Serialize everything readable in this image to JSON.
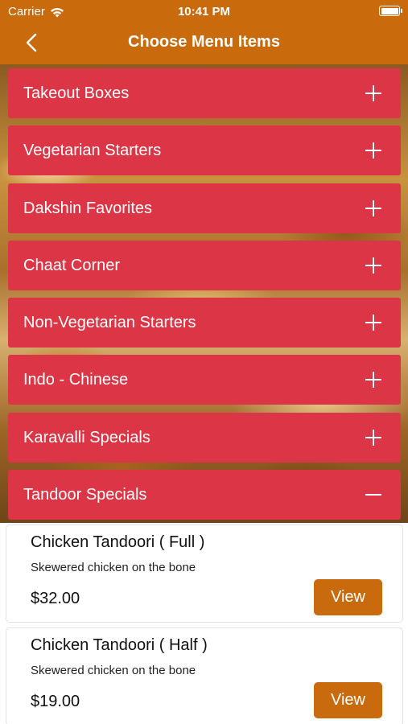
{
  "status_bar": {
    "carrier": "Carrier",
    "time": "10:41 PM"
  },
  "nav": {
    "title": "Choose Menu Items"
  },
  "colors": {
    "nav_bar": "#c96a0c",
    "category_header": "#dc3545",
    "view_button": "#c96a0c"
  },
  "categories": [
    {
      "label": "Takeout Boxes",
      "expanded": false
    },
    {
      "label": "Vegetarian Starters",
      "expanded": false
    },
    {
      "label": "Dakshin Favorites",
      "expanded": false
    },
    {
      "label": "Chaat Corner",
      "expanded": false
    },
    {
      "label": "Non-Vegetarian Starters",
      "expanded": false
    },
    {
      "label": "Indo - Chinese",
      "expanded": false
    },
    {
      "label": "Karavalli Specials",
      "expanded": false
    },
    {
      "label": "Tandoor Specials",
      "expanded": true
    }
  ],
  "items": [
    {
      "name": "Chicken Tandoori ( Full )",
      "description": "Skewered chicken on the bone",
      "price": "$32.00",
      "button_label": "View"
    },
    {
      "name": "Chicken Tandoori ( Half )",
      "description": "Skewered chicken on the bone",
      "price": "$19.00",
      "button_label": "View"
    }
  ]
}
